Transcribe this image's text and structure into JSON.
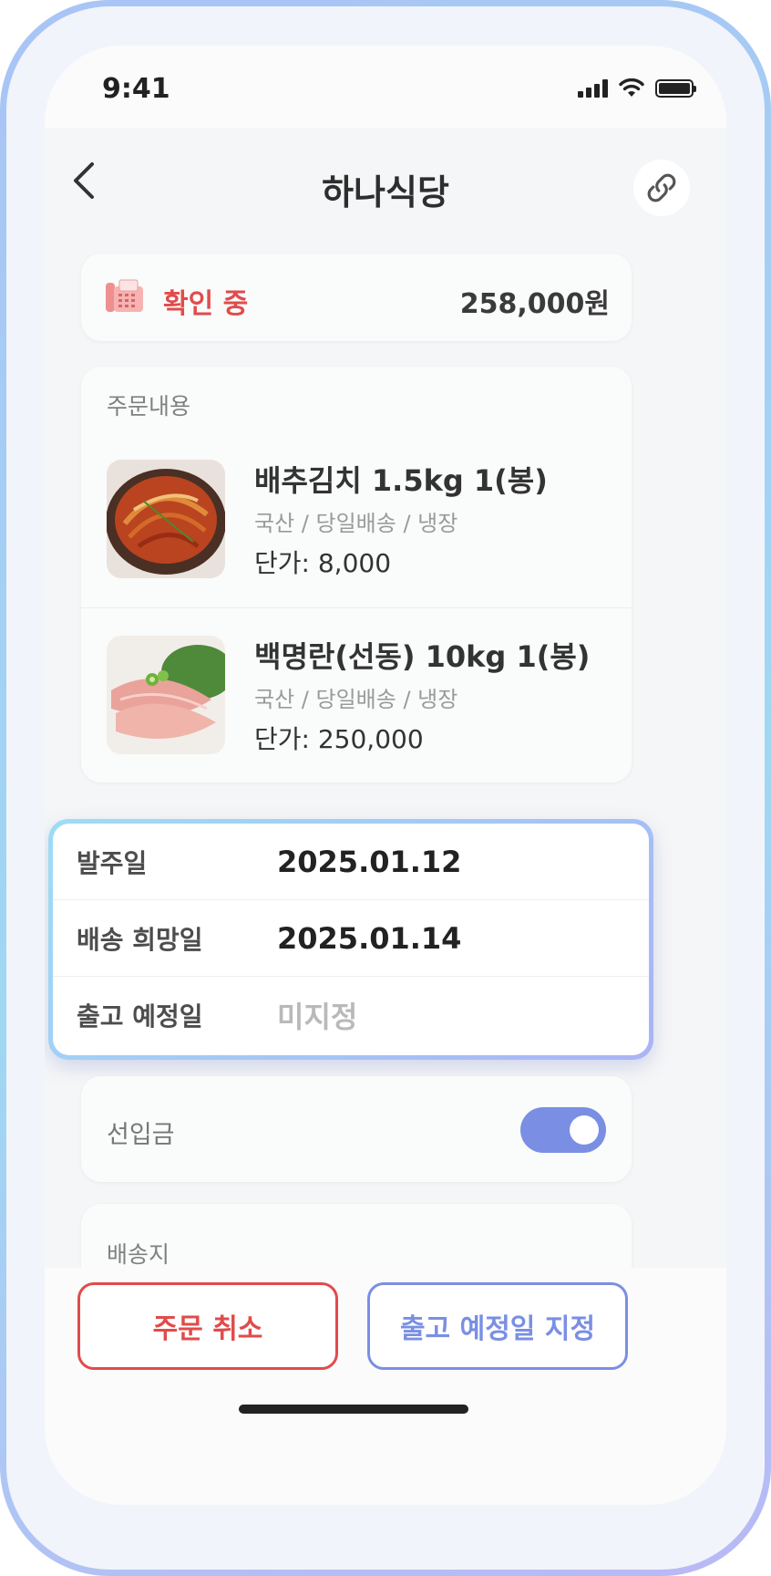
{
  "status_bar": {
    "time": "9:41"
  },
  "header": {
    "title": "하나식당",
    "back_icon": "chevron-left-icon",
    "link_icon": "link-icon"
  },
  "order_status": {
    "label": "확인 중",
    "amount": "258,000원",
    "color": "#e14b4b"
  },
  "order_contents": {
    "title": "주문내용",
    "items": [
      {
        "name": "배추김치 1.5kg 1(봉)",
        "tags": "국산 / 당일배송 / 냉장",
        "price": "단가: 8,000"
      },
      {
        "name": "백명란(선동) 10kg 1(봉)",
        "tags": "국산 / 당일배송 / 냉장",
        "price": "단가: 250,000"
      }
    ]
  },
  "dates": [
    {
      "label": "발주일",
      "value": "2025.01.12"
    },
    {
      "label": "배송 희망일",
      "value": "2025.01.14"
    },
    {
      "label": "출고 예정일",
      "value": "미지정"
    }
  ],
  "prepayment": {
    "label": "선입금",
    "enabled": true
  },
  "address": {
    "label": "배송지"
  },
  "actions": {
    "cancel_label": "주문 취소",
    "schedule_label": "출고 예정일 지정"
  },
  "colors": {
    "accent": "#7a8fe3",
    "danger": "#e14b4b"
  }
}
